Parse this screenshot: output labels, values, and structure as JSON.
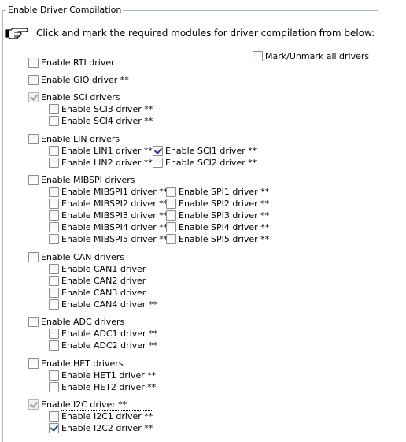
{
  "group": {
    "title": "Enable Driver Compilation"
  },
  "instruction": "Click and mark the required modules for driver compilation from below:",
  "mark_all": {
    "label": "Mark/Unmark all drivers",
    "checked": false
  },
  "options": {
    "rti": {
      "label": "Enable RTI driver",
      "checked": false
    },
    "gio": {
      "label": "Enable GIO driver **",
      "checked": false
    },
    "sci": {
      "label": "Enable SCI drivers",
      "checked": true,
      "disabled": true
    },
    "sci3": {
      "label": "Enable SCI3 driver **",
      "checked": false
    },
    "sci4": {
      "label": "Enable SCI4 driver **",
      "checked": false
    },
    "lin": {
      "label": "Enable LIN drivers",
      "checked": false
    },
    "lin1": {
      "label": "Enable LIN1 driver ** /",
      "checked": false
    },
    "sci1": {
      "label": "Enable SCI1 driver **",
      "checked": true
    },
    "lin2": {
      "label": "Enable LIN2 driver ** /",
      "checked": false
    },
    "sci2": {
      "label": "Enable SCI2 driver **",
      "checked": false
    },
    "mibspi": {
      "label": "Enable MIBSPI drivers",
      "checked": false
    },
    "mibspi1": {
      "label": "Enable MIBSPI1 driver **",
      "checked": false
    },
    "spi1": {
      "label": "Enable SPI1 driver **",
      "checked": false
    },
    "mibspi2": {
      "label": "Enable MIBSPI2 driver **",
      "checked": false
    },
    "spi2": {
      "label": "Enable SPI2 driver **",
      "checked": false
    },
    "mibspi3": {
      "label": "Enable MIBSPI3 driver **",
      "checked": false
    },
    "spi3": {
      "label": "Enable SPI3 driver **",
      "checked": false
    },
    "mibspi4": {
      "label": "Enable MIBSPI4 driver **",
      "checked": false
    },
    "spi4": {
      "label": "Enable SPI4 driver **",
      "checked": false
    },
    "mibspi5": {
      "label": "Enable MIBSPI5 driver **",
      "checked": false
    },
    "spi5": {
      "label": "Enable SPI5 driver **",
      "checked": false
    },
    "can": {
      "label": "Enable CAN drivers",
      "checked": false
    },
    "can1": {
      "label": "Enable CAN1 driver",
      "checked": false
    },
    "can2": {
      "label": "Enable CAN2 driver",
      "checked": false
    },
    "can3": {
      "label": "Enable CAN3 driver",
      "checked": false
    },
    "can4": {
      "label": "Enable CAN4 driver **",
      "checked": false
    },
    "adc": {
      "label": "Enable ADC drivers",
      "checked": false
    },
    "adc1": {
      "label": "Enable ADC1 driver **",
      "checked": false
    },
    "adc2": {
      "label": "Enable ADC2 driver **",
      "checked": false
    },
    "het": {
      "label": "Enable HET drivers",
      "checked": false
    },
    "het1": {
      "label": "Enable HET1 driver **",
      "checked": false
    },
    "het2": {
      "label": "Enable HET2 driver **",
      "checked": false
    },
    "i2c": {
      "label": "Enable I2C driver **",
      "checked": true,
      "disabled": true
    },
    "i2c1": {
      "label": "Enable I2C1 driver **",
      "checked": false,
      "focused": true
    },
    "i2c2": {
      "label": "Enable I2C2 driver **",
      "checked": true
    }
  },
  "icons": {
    "instruction": "pointing-hand-icon"
  },
  "colors": {
    "group_border": "#a3b8cc",
    "check_mark": "#1e3f8f"
  }
}
